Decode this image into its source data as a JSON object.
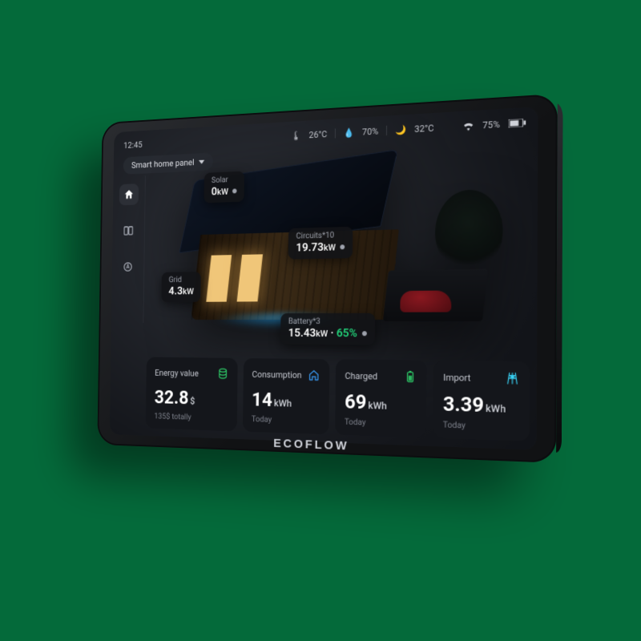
{
  "clock": "12:45",
  "panel_selector": {
    "label": "Smart home panel"
  },
  "status": {
    "temp_in": {
      "value": "26",
      "unit": "°C"
    },
    "humidity": {
      "value": "70",
      "unit": "%"
    },
    "temp_out": {
      "value": "32",
      "unit": "°C"
    },
    "battery": {
      "value": "75",
      "unit": "%"
    }
  },
  "nodes": {
    "solar": {
      "label": "Solar",
      "value": "0",
      "unit": "kW"
    },
    "circuits": {
      "label": "Circuits*10",
      "value": "19.73",
      "unit": "kW"
    },
    "grid": {
      "label": "Grid",
      "value": "4.3",
      "unit": "kW"
    },
    "battery": {
      "label": "Battery*3",
      "value": "15.43",
      "unit": "kW",
      "pct": "65%"
    }
  },
  "cards": {
    "energy": {
      "title": "Energy value",
      "value": "32.8",
      "unit": "$",
      "sub": "135$ totally"
    },
    "consumption": {
      "title": "Consumption",
      "value": "14",
      "unit": "kWh",
      "sub": "Today"
    },
    "charged": {
      "title": "Charged",
      "value": "69",
      "unit": "kWh",
      "sub": "Today"
    },
    "import": {
      "title": "Import",
      "value": "3.39",
      "unit": "kWh",
      "sub": "Today"
    }
  },
  "brand": "ECOFLOW"
}
